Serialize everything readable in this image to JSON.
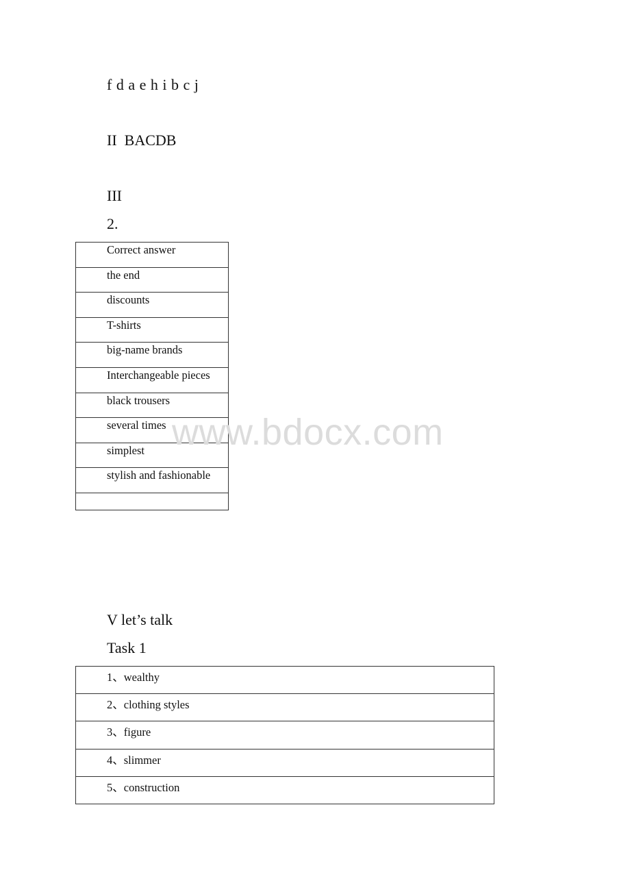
{
  "section_i": {
    "answers": "f d a e h i b c j"
  },
  "section_ii": {
    "label": "II  BACDB"
  },
  "section_iii": {
    "label": "III",
    "item": "2.",
    "table": {
      "rows": [
        "Correct answer",
        "the end",
        "discounts",
        "T-shirts",
        "big-name brands",
        "Interchangeable pieces",
        "black trousers",
        "several times",
        "simplest",
        "stylish and fashionable",
        ""
      ]
    }
  },
  "section_v": {
    "label": "V let’s talk",
    "task": "Task 1",
    "table": {
      "rows": [
        "1、wealthy",
        "2、clothing styles",
        "3、figure",
        "4、slimmer",
        "5、construction"
      ]
    }
  },
  "watermark": "www.bdocx.com"
}
